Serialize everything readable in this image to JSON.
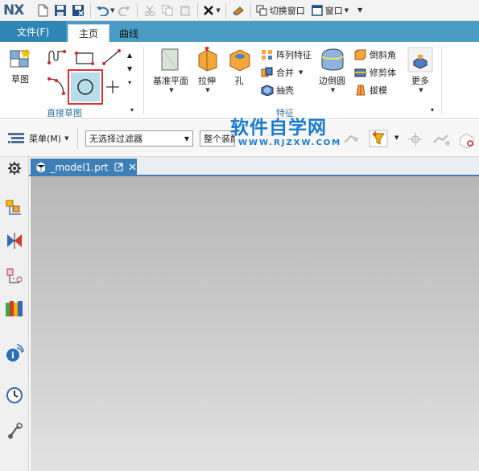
{
  "app": {
    "logo": "NX"
  },
  "quick_access": {
    "switch_window_label": "切换窗口",
    "window_label": "窗口"
  },
  "tabs": [
    {
      "label": "文件(F)"
    },
    {
      "label": "主页"
    },
    {
      "label": "曲线"
    }
  ],
  "ribbon": {
    "sketch_label": "草图",
    "direct_sketch_group": "直接草图",
    "datum_plane_label": "基准平面",
    "extrude_label": "拉伸",
    "hole_label": "孔",
    "pattern_feature_label": "阵列特征",
    "unite_label": "合并",
    "shell_label": "抽壳",
    "edge_blend_label": "边倒圆",
    "chamfer_label": "倒斜角",
    "trim_body_label": "修剪体",
    "draft_label": "拔模",
    "more_label": "更多",
    "feature_group": "特征"
  },
  "selection_bar": {
    "menu_label": "菜单(M)",
    "filter_value": "无选择过滤器",
    "scope_value": "整个装配"
  },
  "watermark": {
    "title": "软件自学网",
    "url": "WWW.RJZXW.COM"
  },
  "document": {
    "tab_label": "_model1.prt"
  },
  "colors": {
    "tab_bar": "#4b9cc4",
    "file_tab": "#2f86b4",
    "doc_tab": "#3d7fb6",
    "highlight_border": "#e0302a",
    "watermark": "#1a7ad0"
  }
}
